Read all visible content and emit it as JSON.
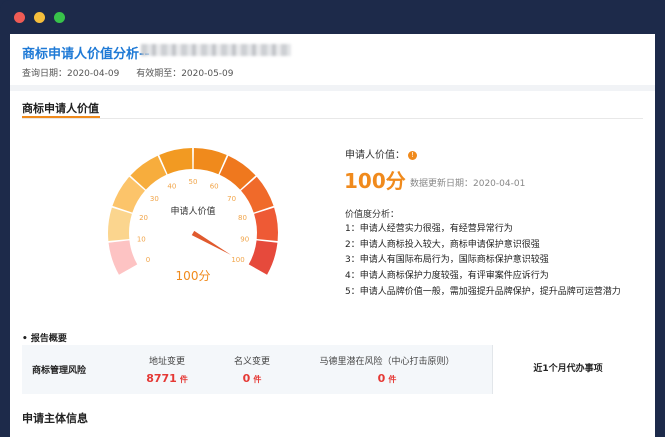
{
  "header": {
    "title": "商标申请人价值分析--",
    "query_date": "查询日期：2020-04-09",
    "valid_until": "有效期至：2020-05-09"
  },
  "section": {
    "title": "商标申请人价值"
  },
  "gauge": {
    "label": "申请人价值",
    "value_text": "100分",
    "value": 100,
    "min": 0,
    "max": 100,
    "ticks": [
      "0",
      "10",
      "20",
      "30",
      "40",
      "50",
      "60",
      "70",
      "80",
      "90",
      "100"
    ],
    "colors": [
      "#fdc3c3",
      "#fbd58e",
      "#fcc46a",
      "#f7ad3d",
      "#f29a22",
      "#f08a1c",
      "#ef781e",
      "#f06a2a",
      "#ee5a35",
      "#e64a3c"
    ]
  },
  "summary": {
    "value_label": "申请人价值：",
    "info_icon": "!",
    "value_text": "100分",
    "update_date": "数据更新日期：2020-04-01",
    "analysis_title": "价值度分析：",
    "analysis_items": [
      "1：申请人经营实力很强，有经营异常行为",
      "2：申请人商标投入较大，商标申请保护意识很强",
      "3：申请人有国际布局行为，国际商标保护意识较强",
      "4：申请人商标保护力度较强，有评审案件应诉行为",
      "5：申请人品牌价值一般，需加强提升品牌保护，提升品牌可运营潜力"
    ]
  },
  "report": {
    "title": "• 报告概要",
    "main_label": "商标管理风险",
    "metrics": [
      {
        "label": "地址变更",
        "value": "8771",
        "unit": "件"
      },
      {
        "label": "名义变更",
        "value": "0",
        "unit": "件"
      },
      {
        "label": "马德里潜在风险（中心打击原则）",
        "value": "0",
        "unit": "件"
      }
    ],
    "right_label": "近1个月代办事项"
  },
  "next_section": {
    "title": "申请主体信息"
  },
  "theme": {
    "accent": "#f08a1c",
    "link": "#1f7ad6",
    "alert": "#e53935"
  }
}
